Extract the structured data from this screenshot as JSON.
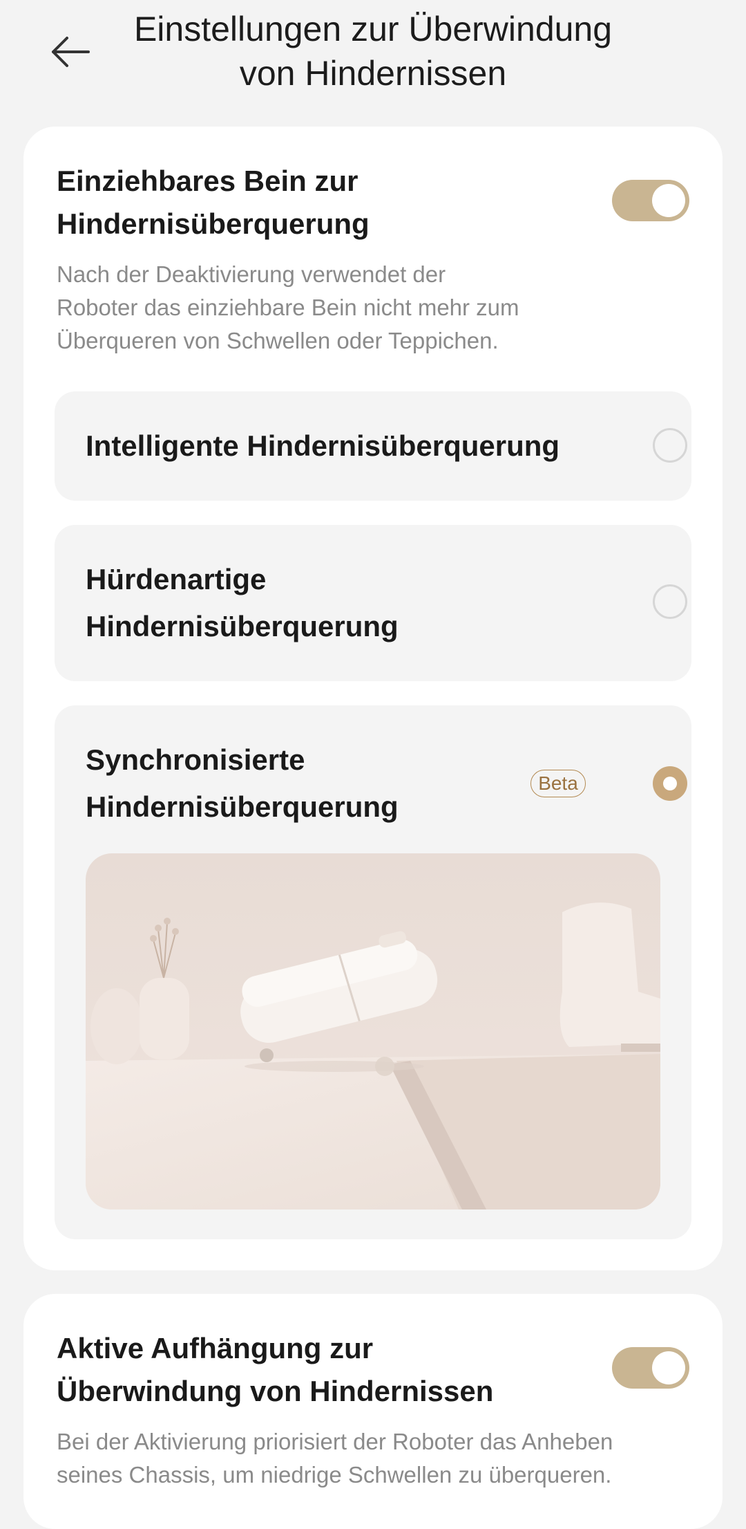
{
  "header": {
    "title_line1": "Einstellungen zur Überwindung",
    "title_line2": "von Hindernissen"
  },
  "leg_section": {
    "title_line1": "Einziehbares Bein zur",
    "title_line2": "Hindernisüberquerung",
    "toggle_on": true,
    "desc_line1": "Nach der Deaktivierung verwendet der",
    "desc_line2": "Roboter das einziehbare Bein nicht mehr zum",
    "desc_line3": "Überqueren von Schwellen oder Teppichen.",
    "options": [
      {
        "label_line1": "Intelligente Hindernisüberquerung",
        "selected": false
      },
      {
        "label_line1": "Hürdenartige",
        "label_line2": "Hindernisüberquerung",
        "selected": false
      },
      {
        "label_line1": "Synchronisierte",
        "label_line2": "Hindernisüberquerung",
        "badge": "Beta",
        "selected": true
      }
    ]
  },
  "suspension_section": {
    "title_line1": "Aktive Aufhängung zur",
    "title_line2": "Überwindung von Hindernissen",
    "toggle_on": true,
    "desc_line1": "Bei der Aktivierung priorisiert der Roboter das Anheben",
    "desc_line2": "seines Chassis, um niedrige Schwellen zu überqueren."
  },
  "colors": {
    "accent": "#c9b592",
    "radio_selected": "#c9a87c",
    "badge": "#9a7240",
    "background": "#f3f3f3"
  },
  "icons": {
    "back": "arrow-left-icon"
  }
}
